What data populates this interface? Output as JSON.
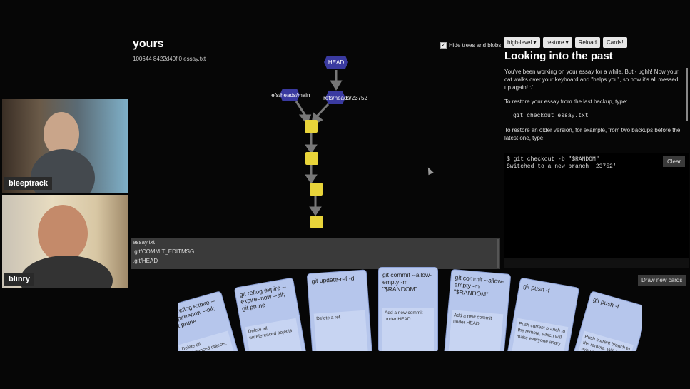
{
  "cams": [
    {
      "name": "bleeptrack"
    },
    {
      "name": "blinry"
    }
  ],
  "repo": {
    "title": "yours",
    "entry": "100644 8422d40f 0 essay.txt",
    "hide_label": "Hide trees and blobs",
    "refs": {
      "head": "HEAD",
      "main": "refs/heads/main",
      "branch": "refs/heads/23752"
    },
    "files": [
      "essay.txt",
      ".git/COMMIT_EDITMSG",
      ".git/HEAD"
    ]
  },
  "toolbar": {
    "level": "high-level",
    "chapter": "restore",
    "reload": "Reload",
    "cards": "Cards!"
  },
  "guide": {
    "title": "Looking into the past",
    "p1": "You've been working on your essay for a while. But - ughh! Now your cat walks over your keyboard and \"helps you\", so now it's all messed up again! :/",
    "p2": "To restore your essay from the last backup, type:",
    "code": "git checkout essay.txt",
    "p3": "To restore an older version, for example, from two backups before the latest one, type:"
  },
  "terminal": {
    "line1": "$ git checkout -b \"$RANDOM\"",
    "line2": "Switched to a new branch '23752'",
    "clear": "Clear"
  },
  "draw_button": "Draw new cards",
  "cards": [
    {
      "cmd": "git reflog expire --expire=now --all; git prune",
      "desc": "Delete all unreferenced objects."
    },
    {
      "cmd": "git reflog expire --expire=now --all; git prune",
      "desc": "Delete all unreferenced objects."
    },
    {
      "cmd": "git update-ref -d",
      "desc": "Delete a ref."
    },
    {
      "cmd": "git commit --allow-empty -m \"$RANDOM\"",
      "desc": "Add a new commit under HEAD."
    },
    {
      "cmd": "git commit --allow-empty -m \"$RANDOM\"",
      "desc": "Add a new commit under HEAD."
    },
    {
      "cmd": "git push -f",
      "desc": "Push current branch to the remote, which will make everyone angry."
    },
    {
      "cmd": "git push -f",
      "desc": "Push current branch to the remote. Will make everyone angry."
    }
  ]
}
